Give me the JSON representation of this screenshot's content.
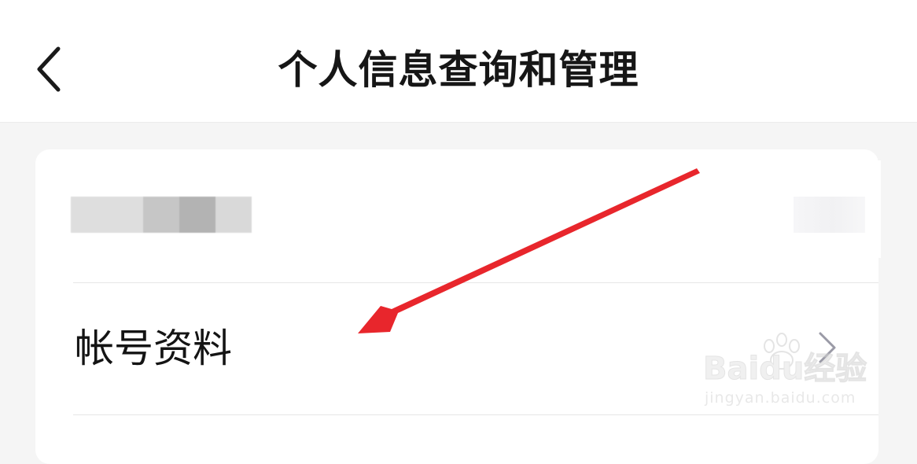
{
  "header": {
    "title": "个人信息查询和管理",
    "back_icon": "chevron-left-icon"
  },
  "card": {
    "account_name_redacted": true,
    "rows": [
      {
        "label": "帐号资料",
        "icon": "chevron-right-icon"
      }
    ]
  },
  "watermark": {
    "brand": "Baidu经验",
    "url": "jingyan.baidu.com"
  },
  "colors": {
    "header_bg": "#ffffff",
    "page_bg": "#f5f5f5",
    "card_bg": "#ffffff",
    "title_text": "#161616",
    "chevron": "#9a9aa6",
    "annotation_arrow": "#e8262c"
  }
}
